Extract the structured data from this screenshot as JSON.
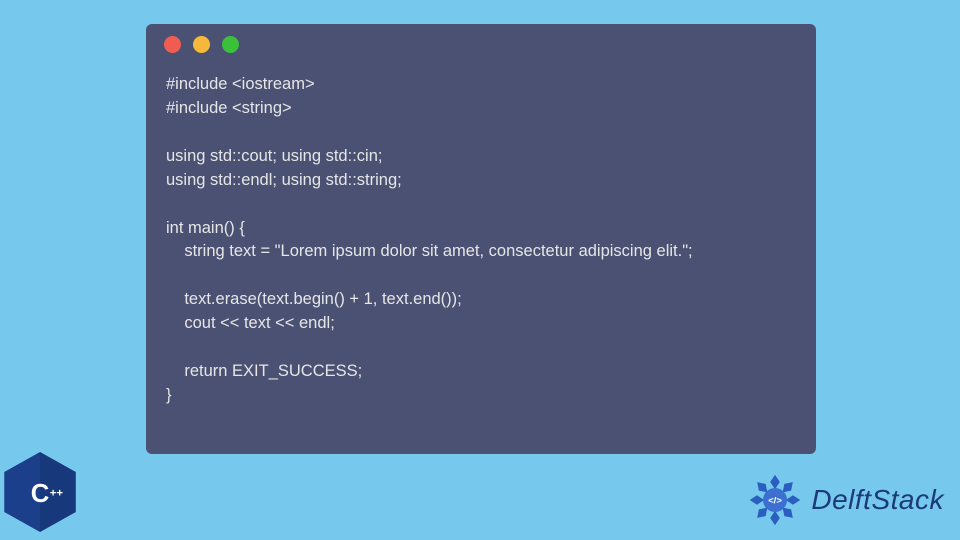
{
  "window": {
    "dots": [
      "red",
      "yellow",
      "green"
    ]
  },
  "code": {
    "lines": [
      "#include <iostream>",
      "#include <string>",
      "",
      "using std::cout; using std::cin;",
      "using std::endl; using std::string;",
      "",
      "int main() {",
      "    string text = \"Lorem ipsum dolor sit amet, consectetur adipiscing elit.\";",
      "",
      "    text.erase(text.begin() + 1, text.end());",
      "    cout << text << endl;",
      "",
      "    return EXIT_SUCCESS;",
      "}"
    ]
  },
  "badges": {
    "cpp_label": "C++"
  },
  "brand": {
    "name": "DelftStack"
  },
  "colors": {
    "page_bg": "#76c8ed",
    "window_bg": "#4b5173",
    "code_text": "#e6e6e6",
    "cpp_badge": "#1b3f8b",
    "brand_text": "#1a3a7a",
    "brand_logo": "#2b5fbf"
  }
}
